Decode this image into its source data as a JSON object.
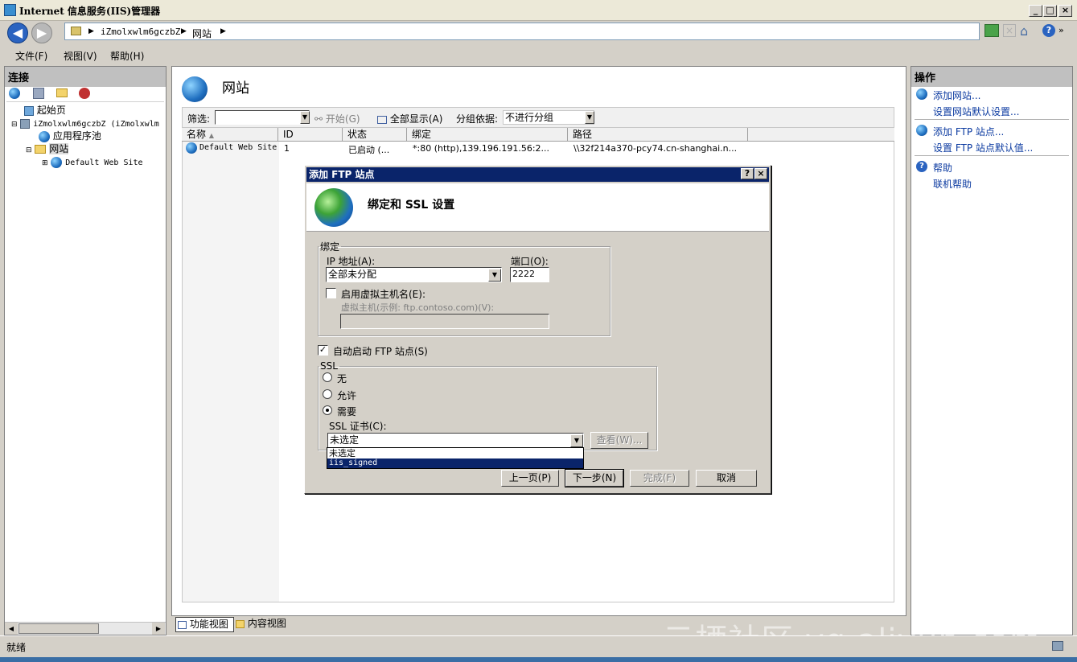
{
  "window": {
    "title": "Internet 信息服务(IIS)管理器"
  },
  "address": {
    "crumbs": [
      "iZmolxwlm6gczbZ",
      "网站"
    ]
  },
  "menu": {
    "file": "文件(F)",
    "view": "视图(V)",
    "help": "帮助(H)"
  },
  "left": {
    "header": "连接",
    "tree": {
      "start": "起始页",
      "server": "iZmolxwlm6gczbZ (iZmolxwlm",
      "apppools": "应用程序池",
      "sites": "网站",
      "site1": "Default Web Site"
    }
  },
  "center": {
    "title": "网站",
    "filter_label": "筛选:",
    "start_btn": "开始(G)",
    "showall_btn": "全部显示(A)",
    "groupby_label": "分组依据:",
    "groupby_value": "不进行分组",
    "columns": [
      "名称",
      "ID",
      "状态",
      "绑定",
      "路径"
    ],
    "row": {
      "name": "Default Web Site",
      "id": "1",
      "status": "已启动 (...",
      "binding": "*:80 (http),139.196.191.56:2...",
      "path": "\\\\32f214a370-pcy74.cn-shanghai.n..."
    }
  },
  "right": {
    "header": "操作",
    "actions": {
      "add_site": "添加网站...",
      "site_defaults": "设置网站默认设置...",
      "add_ftp": "添加 FTP 站点...",
      "ftp_defaults": "设置 FTP 站点默认值...",
      "help": "帮助",
      "online_help": "联机帮助"
    }
  },
  "dialog": {
    "title": "添加 FTP 站点",
    "heading": "绑定和 SSL 设置",
    "binding_legend": "绑定",
    "ip_label": "IP 地址(A):",
    "ip_value": "全部未分配",
    "port_label": "端口(O):",
    "port_value": "2222",
    "vhost_label": "启用虚拟主机名(E):",
    "vhost_field_label": "虚拟主机(示例: ftp.contoso.com)(V):",
    "autostart_label": "自动启动 FTP 站点(S)",
    "ssl_legend": "SSL",
    "ssl_none": "无",
    "ssl_allow": "允许",
    "ssl_require": "需要",
    "cert_label": "SSL 证书(C):",
    "cert_value": "未选定",
    "view_btn": "查看(W)...",
    "cert_options": [
      "未选定",
      "iis_signed"
    ],
    "prev_btn": "上一页(P)",
    "next_btn": "下一步(N)",
    "finish_btn": "完成(F)",
    "cancel_btn": "取消"
  },
  "tabs": {
    "features": "功能视图",
    "content": "内容视图"
  },
  "status": {
    "text": "就绪"
  },
  "watermark": "云栖社区 yq.aliyun.com"
}
